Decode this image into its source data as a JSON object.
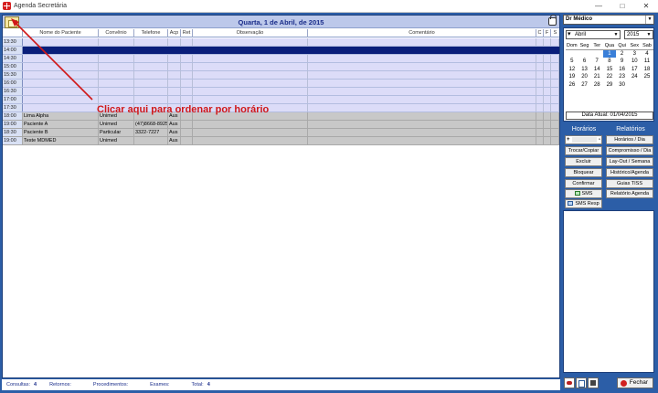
{
  "window": {
    "title": "Agenda Secretária",
    "minimize": "—",
    "maximize": "□",
    "close": "✕"
  },
  "header": {
    "date": "Quarta, 1 de Abril, de 2015"
  },
  "columns": [
    "Nome do Paciente",
    "Convênio",
    "Telefone",
    "Acp",
    "Ret",
    "Observação",
    "Comentário",
    "C",
    "F",
    "S"
  ],
  "slots": [
    "13:30",
    "14:00",
    "14:30",
    "15:00",
    "15:30",
    "16:00",
    "16:30",
    "17:00",
    "17:30"
  ],
  "appointments": [
    {
      "time": "18:00",
      "name": "Lima Alpha",
      "insurance": "Unimed",
      "phone": "",
      "status": "Aus"
    },
    {
      "time": "19:00",
      "name": "Paciente A",
      "insurance": "Unimed",
      "phone": "(47)8668-8925",
      "status": "Aus"
    },
    {
      "time": "18:30",
      "name": "Paciente B",
      "insurance": "Particular",
      "phone": "3322-7227",
      "status": "Aus"
    },
    {
      "time": "19:00",
      "name": "Teste MDMED",
      "insurance": "Unimed",
      "phone": "",
      "status": "Aus"
    }
  ],
  "annotation": "Clicar aqui para ordenar por horário",
  "status": {
    "consultas_label": "Consultas:",
    "consultas_value": "4",
    "retornos_label": "Retornos:",
    "retornos_value": "",
    "procedimentos_label": "Procedimentos:",
    "procedimentos_value": "",
    "exames_label": "Exames:",
    "exames_value": "",
    "total_label": "Total:",
    "total_value": "4"
  },
  "doctor": {
    "selected": "Dr Médico"
  },
  "calendar": {
    "month": "Abril",
    "year": "2015",
    "dow": [
      "Dom",
      "Seg",
      "Ter",
      "Qua",
      "Qui",
      "Sex",
      "Sab"
    ],
    "weeks": [
      [
        "",
        "",
        "",
        "1",
        "2",
        "3",
        "4"
      ],
      [
        "5",
        "6",
        "7",
        "8",
        "9",
        "10",
        "11"
      ],
      [
        "12",
        "13",
        "14",
        "15",
        "16",
        "17",
        "18"
      ],
      [
        "19",
        "20",
        "21",
        "22",
        "23",
        "24",
        "25"
      ],
      [
        "26",
        "27",
        "28",
        "29",
        "30",
        "",
        ""
      ]
    ],
    "today": "1",
    "date_atual": "Data Atual: 01/04/2015"
  },
  "horarios": {
    "title": "Horários",
    "plus": "+",
    "minus": "-",
    "trocar": "Trocar/Copiar",
    "excluir": "Excluir",
    "bloquear": "Bloquear",
    "confirmar": "Confirmar",
    "sms": "SMS",
    "sms_resp": "SMS Resp"
  },
  "relatorios": {
    "title": "Relatórios",
    "horarios_dia": "Horários / Dia",
    "compromisso_dia": "Compromisso / Dia",
    "layout_semana": "Lay-Out / Semana",
    "historico_agenda": "Histórico/Agenda",
    "guias_tiss": "Guias TISS",
    "relatorio_agenda": "Relatório Agenda"
  },
  "footer": {
    "close": "Fechar"
  },
  "colors": {
    "accent": "#2c5ea7",
    "selected_row": "#0a1e7a",
    "annotation": "#d01818"
  }
}
